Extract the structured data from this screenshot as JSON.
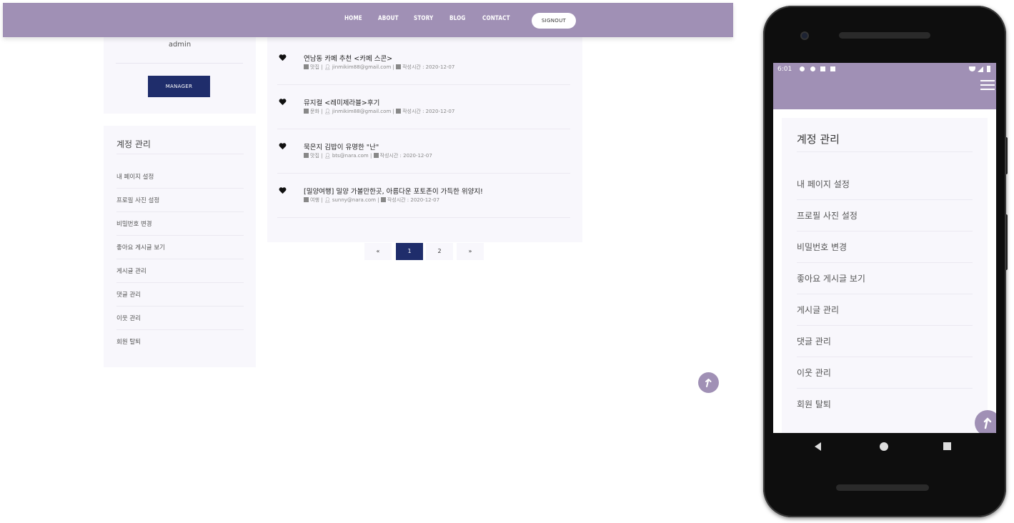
{
  "colors": {
    "accent": "#a090b5",
    "navy": "#1f2d6b",
    "panel": "#f8f7fc"
  },
  "nav": {
    "links": [
      "HOME",
      "ABOUT",
      "STORY",
      "BLOG",
      "CONTACT"
    ],
    "signout": "SIGNOUT"
  },
  "profile": {
    "name": "admin",
    "manager_btn": "MANAGER"
  },
  "account": {
    "title": "계정 관리",
    "items": [
      "내 페이지 설정",
      "프로필 사진 설정",
      "비밀번호 변경",
      "좋아요 게시글 보기",
      "게시글 관리",
      "댓글 관리",
      "이웃 관리",
      "회원 탈퇴"
    ]
  },
  "posts": [
    {
      "title": "연남동 카페 추천 <카페 스콘>",
      "category": "맛집",
      "email": "jinmikim88@gmail.com",
      "date_label": "작성시간 : 2020-12-07"
    },
    {
      "title": "뮤지컬 <레미제라블>후기",
      "category": "문화",
      "email": "jinmikim88@gmail.com",
      "date_label": "작성시간 : 2020-12-07"
    },
    {
      "title": "묵은지 김밥이 유명한 \"난\"",
      "category": "맛집",
      "email": "bts@nara.com",
      "date_label": "작성시간 : 2020-12-07"
    },
    {
      "title": "[밀양여행] 밀양 가볼만한곳, 아름다운 포토존이 가득한 위양지!",
      "category": "여행",
      "email": "sunny@nara.com",
      "date_label": "작성시간 : 2020-12-07"
    }
  ],
  "pagination": {
    "prev": "«",
    "pages": [
      "1",
      "2"
    ],
    "next": "»",
    "active": "1"
  },
  "phone": {
    "time": "6:01",
    "title": "계정 관리",
    "items": [
      "내 페이지 설정",
      "프로필 사진 설정",
      "비밀번호 변경",
      "좋아요 게시글 보기",
      "게시글 관리",
      "댓글 관리",
      "이웃 관리",
      "회원 탈퇴"
    ]
  }
}
